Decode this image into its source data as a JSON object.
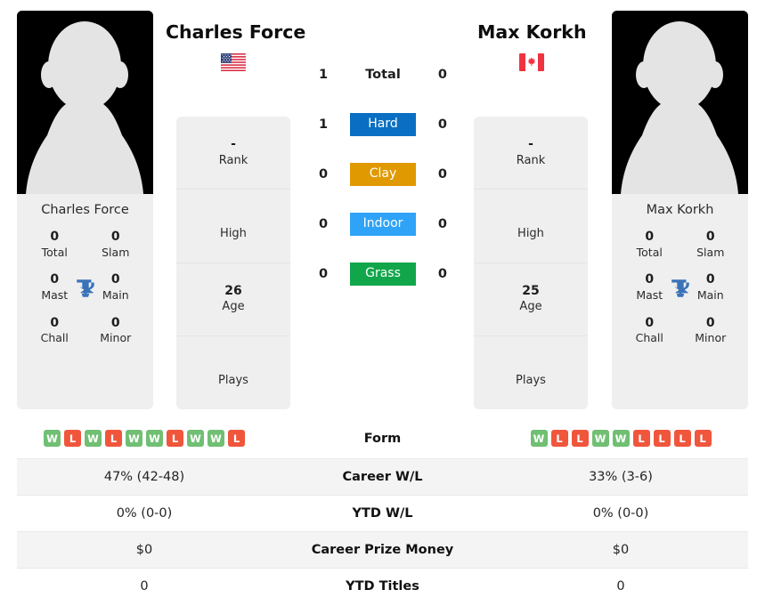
{
  "players": {
    "left": {
      "name": "Charles Force",
      "card_name": "Charles Force",
      "flag": "us-flag-icon",
      "rank": "-",
      "rank_label": "Rank",
      "high": "",
      "high_label": "High",
      "age": "26",
      "age_label": "Age",
      "plays": "",
      "plays_label": "Plays",
      "titles": {
        "total": "0",
        "total_label": "Total",
        "slam": "0",
        "slam_label": "Slam",
        "mast": "0",
        "mast_label": "Mast",
        "main": "0",
        "main_label": "Main",
        "chall": "0",
        "chall_label": "Chall",
        "minor": "0",
        "minor_label": "Minor"
      },
      "form": [
        "W",
        "L",
        "W",
        "L",
        "W",
        "W",
        "L",
        "W",
        "W",
        "L"
      ],
      "career_wl": "47% (42-48)",
      "ytd_wl": "0% (0-0)",
      "career_prize": "$0",
      "ytd_titles": "0"
    },
    "right": {
      "name": "Max Korkh",
      "card_name": "Max Korkh",
      "flag": "ca-flag-icon",
      "rank": "-",
      "rank_label": "Rank",
      "high": "",
      "high_label": "High",
      "age": "25",
      "age_label": "Age",
      "plays": "",
      "plays_label": "Plays",
      "titles": {
        "total": "0",
        "total_label": "Total",
        "slam": "0",
        "slam_label": "Slam",
        "mast": "0",
        "mast_label": "Mast",
        "main": "0",
        "main_label": "Main",
        "chall": "0",
        "chall_label": "Chall",
        "minor": "0",
        "minor_label": "Minor"
      },
      "form": [
        "W",
        "L",
        "L",
        "W",
        "W",
        "L",
        "L",
        "L",
        "L"
      ],
      "career_wl": "33% (3-6)",
      "ytd_wl": "0% (0-0)",
      "career_prize": "$0",
      "ytd_titles": "0"
    }
  },
  "h2h": {
    "rows": [
      {
        "label": "Total",
        "left": "1",
        "right": "0",
        "type": "total"
      },
      {
        "label": "Hard",
        "left": "1",
        "right": "0",
        "type": "surface",
        "color": "#0a6fc2"
      },
      {
        "label": "Clay",
        "left": "0",
        "right": "0",
        "type": "surface",
        "color": "#e09900"
      },
      {
        "label": "Indoor",
        "left": "0",
        "right": "0",
        "type": "surface",
        "color": "#2fa3f7"
      },
      {
        "label": "Grass",
        "left": "0",
        "right": "0",
        "type": "surface",
        "color": "#11a64a"
      }
    ]
  },
  "stats_table": {
    "rows": [
      {
        "label": "Form",
        "key": "form",
        "shaded": false
      },
      {
        "label": "Career W/L",
        "key": "career_wl",
        "shaded": true
      },
      {
        "label": "YTD W/L",
        "key": "ytd_wl",
        "shaded": false
      },
      {
        "label": "Career Prize Money",
        "key": "career_prize",
        "shaded": true
      },
      {
        "label": "YTD Titles",
        "key": "ytd_titles",
        "shaded": false
      }
    ]
  },
  "colors": {
    "win": "#70bf73",
    "loss": "#f0563c",
    "trophy": "#3a72b8",
    "card_bg": "#efefef",
    "row_shade": "#f4f4f4"
  }
}
